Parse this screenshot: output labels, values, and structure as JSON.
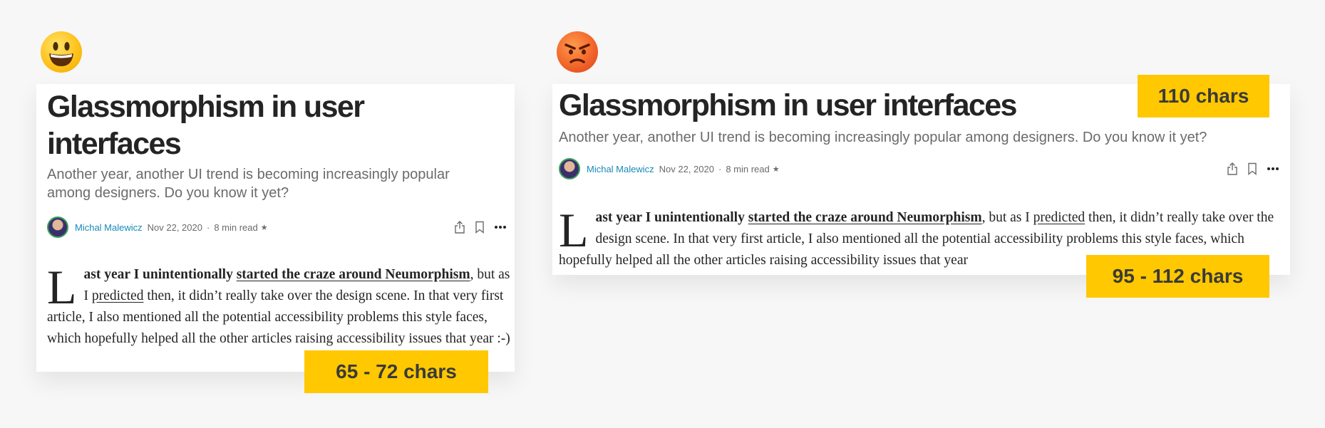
{
  "colors": {
    "background": "#f7f7f7",
    "badge": "#ffc800",
    "author": "#1789b8"
  },
  "emojis": {
    "left": "smiling-face-icon",
    "right": "angry-face-icon"
  },
  "left_article": {
    "title": "Glassmorphism in user interfaces",
    "subtitle": "Another year, another UI trend is becoming increasingly popular among designers. Do you know it yet?",
    "author": "Michal Malewicz",
    "date": "Nov 22, 2020",
    "separator": "·",
    "read_time": "8 min read",
    "star": "★",
    "body": {
      "dropcap": "L",
      "bold_prefix": "ast year I unintentionally ",
      "link1": "started the craze around Neumorphism",
      "after_link1": ", but as I ",
      "link2": "predicted",
      "rest": " then, it didn’t really take over the design scene. In that very first article, I also mentioned all the potential accessibility problems this style faces, which hopefully helped all the other articles raising accessibility issues that year :-)"
    }
  },
  "right_article": {
    "title": "Glassmorphism in user interfaces",
    "subtitle": "Another year, another UI trend is becoming increasingly popular among designers. Do you know it yet?",
    "author": "Michal Malewicz",
    "date": "Nov 22, 2020",
    "separator": "·",
    "read_time": "8 min read",
    "star": "★",
    "body": {
      "dropcap": "L",
      "bold_prefix": "ast year I unintentionally ",
      "link1": "started the craze around Neumorphism",
      "after_link1": ", but as I ",
      "link2": "predicted",
      "rest": " then, it didn’t really take over the design scene. In that very first article, I also mentioned all the potential accessibility problems this style faces, which hopefully helped all the other articles raising accessibility issues that year"
    }
  },
  "badges": {
    "left": "65 - 72 chars",
    "title_right": "110 chars",
    "body_right": "95 - 112 chars"
  }
}
